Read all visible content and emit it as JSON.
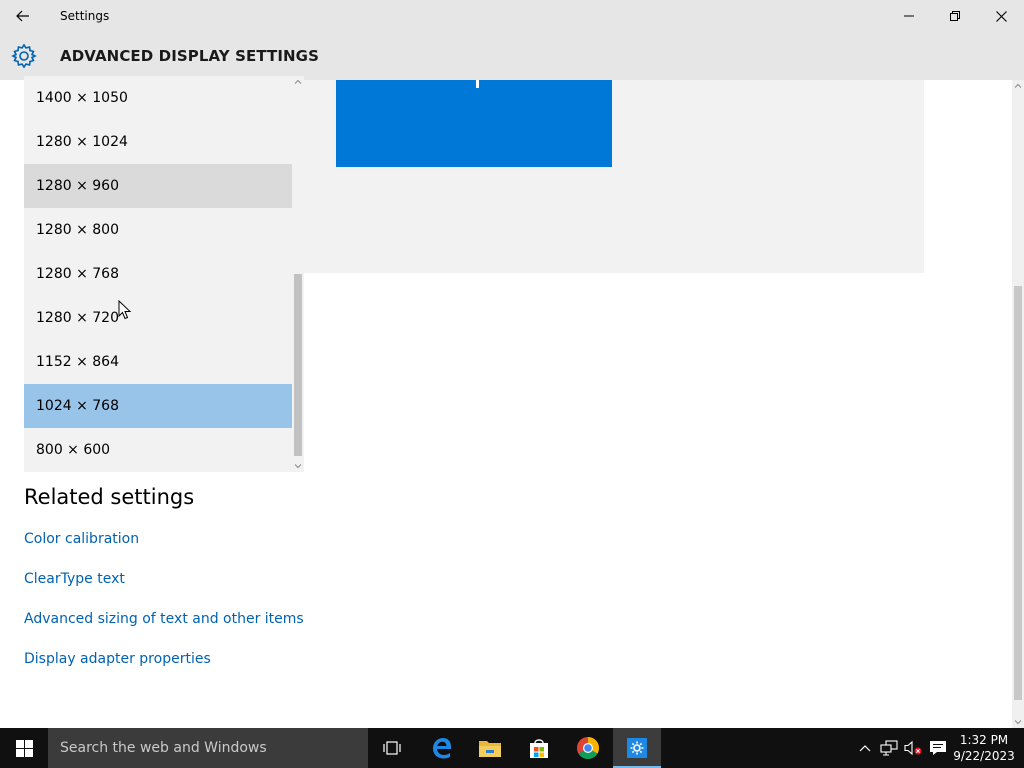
{
  "window": {
    "title": "Settings"
  },
  "header": {
    "title": "ADVANCED DISPLAY SETTINGS"
  },
  "resolution_dropdown": {
    "options": [
      "1400 × 1050",
      "1280 × 1024",
      "1280 × 960",
      "1280 × 800",
      "1280 × 768",
      "1280 × 720",
      "1152 × 864",
      "1024 × 768",
      "800 × 600"
    ],
    "selected": "1024 × 768",
    "hovered": "1280 × 960"
  },
  "related_settings": {
    "heading": "Related settings",
    "links": [
      "Color calibration",
      "ClearType text",
      "Advanced sizing of text and other items",
      "Display adapter properties"
    ]
  },
  "taskbar": {
    "search_placeholder": "Search the web and Windows",
    "time": "1:32 PM",
    "date": "9/22/2023"
  },
  "colors": {
    "accent": "#0078d7",
    "selected_option": "#99c4ea",
    "link": "#0063b1",
    "taskbar": "#101010"
  }
}
